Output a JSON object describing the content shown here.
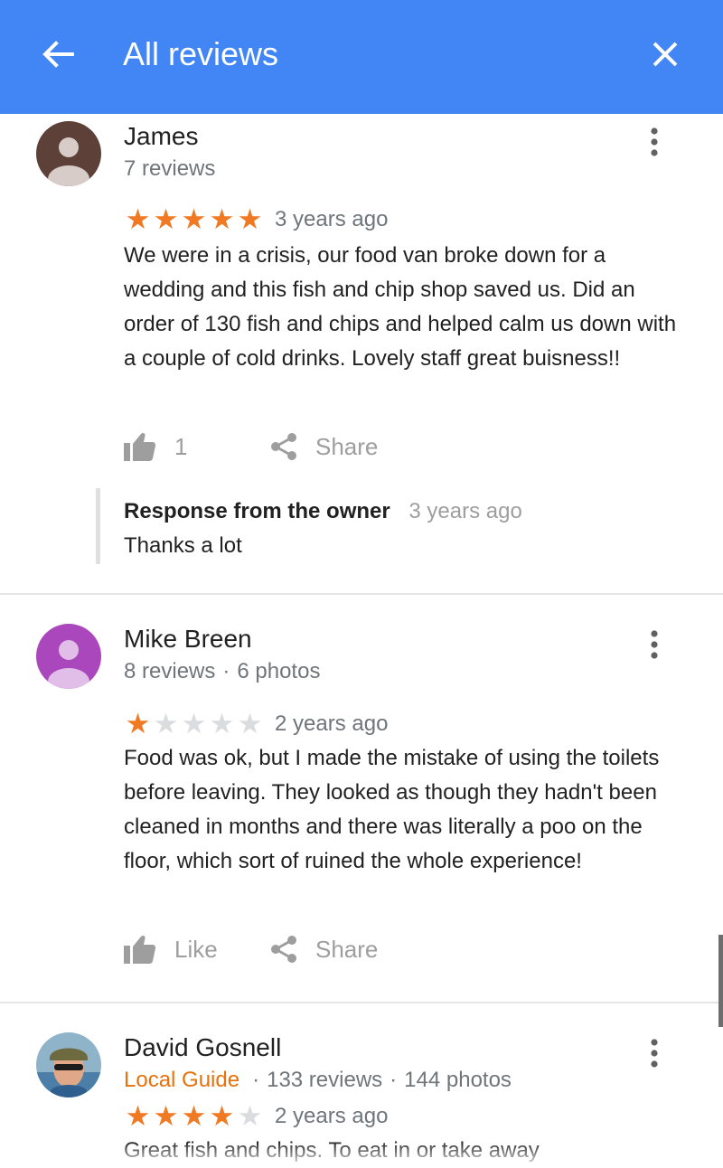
{
  "header": {
    "title": "All reviews",
    "bg_color": "#4285f4"
  },
  "reviews": [
    {
      "name": "James",
      "meta": "7 reviews",
      "rating": 5,
      "when": "3 years ago",
      "text": "We were in a crisis, our food van broke down for a wedding and this fish and chip shop saved us. Did an order of 130 fish and chips and helped calm us down with a couple of cold drinks. Lovely staff great buisness!!",
      "like_label": "1",
      "share_label": "Share",
      "avatar_color": "#5d4037",
      "owner_response": {
        "title": "Response from the owner",
        "when": "3 years ago",
        "text": "Thanks a lot"
      }
    },
    {
      "name": "Mike Breen",
      "reviews_count": "8 reviews",
      "photos_count": "6 photos",
      "rating": 1,
      "when": "2 years ago",
      "text": "Food was ok, but I made the mistake of using the toilets before leaving. They looked as though they hadn't been cleaned in months and there was literally a poo on the floor, which sort of ruined the whole experience!",
      "like_label": "Like",
      "share_label": "Share",
      "avatar_color": "#ab47bc"
    },
    {
      "name": "David Gosnell",
      "badge": "Local Guide",
      "reviews_count": "133 reviews",
      "photos_count": "144 photos",
      "rating": 4,
      "when": "2 years ago",
      "text": "Great fish and chips. To eat in or take away"
    }
  ],
  "colors": {
    "star_on": "#f07a24",
    "star_off": "#dadce0",
    "local_guide": "#e8710a"
  }
}
